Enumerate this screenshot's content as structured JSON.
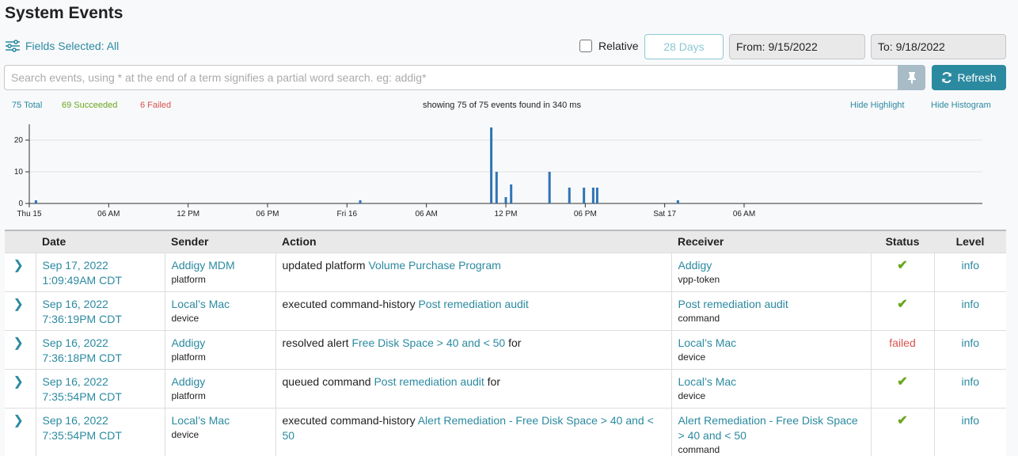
{
  "page": {
    "title": "System Events"
  },
  "toolbar": {
    "fields_label": "Fields Selected: All",
    "relative_label": "Relative",
    "days_label": "28 Days",
    "from_label": "From: 9/15/2022",
    "to_label": "To: 9/18/2022",
    "search_placeholder": "Search events, using * at the end of a term signifies a partial word search. eg: addig*",
    "refresh_label": "Refresh"
  },
  "summary": {
    "total": "75 Total",
    "succeeded": "69 Succeeded",
    "failed": "6 Failed",
    "showing": "showing 75 of 75 events found in 340 ms",
    "hide_highlight": "Hide Highlight",
    "hide_histogram": "Hide Histogram"
  },
  "chart_data": {
    "type": "bar",
    "ylim": [
      0,
      25
    ],
    "yticks": [
      0,
      10,
      20
    ],
    "xlim": [
      0,
      72
    ],
    "xticks": [
      {
        "t": 0,
        "label": "Thu 15"
      },
      {
        "t": 6,
        "label": "06 AM"
      },
      {
        "t": 12,
        "label": "12 PM"
      },
      {
        "t": 18,
        "label": "06 PM"
      },
      {
        "t": 24,
        "label": "Fri 16"
      },
      {
        "t": 30,
        "label": "06 AM"
      },
      {
        "t": 36,
        "label": "12 PM"
      },
      {
        "t": 42,
        "label": "06 PM"
      },
      {
        "t": 48,
        "label": "Sat 17"
      },
      {
        "t": 54,
        "label": "06 AM"
      }
    ],
    "series": [
      {
        "x": [
          0.5,
          25.0,
          34.9,
          35.3,
          36.0,
          36.4,
          39.3,
          40.8,
          41.9,
          42.6,
          42.9,
          49.0
        ],
        "values": [
          1,
          1,
          24,
          10,
          2,
          6,
          10,
          5,
          5,
          5,
          5,
          1
        ]
      }
    ],
    "color": "#2f74b5"
  },
  "table": {
    "headers": [
      "Date",
      "Sender",
      "Action",
      "Receiver",
      "Status",
      "Level"
    ],
    "rows": [
      {
        "date1": "Sep 17, 2022",
        "date2": "1:09:49AM CDT",
        "sender": "Addigy MDM",
        "sender_type": "platform",
        "action_pre": "updated platform ",
        "action_link": "Volume Purchase Program",
        "action_post": "",
        "receiver": "Addigy",
        "receiver_type": "vpp-token",
        "status": "",
        "level": "info"
      },
      {
        "date1": "Sep 16, 2022",
        "date2": "7:36:19PM CDT",
        "sender": "Local’s Mac",
        "sender_type": "device",
        "action_pre": "executed command-history ",
        "action_link": "Post remediation audit",
        "action_post": "",
        "receiver": "Post remediation audit",
        "receiver_type": "command",
        "status": "",
        "level": "info"
      },
      {
        "date1": "Sep 16, 2022",
        "date2": "7:36:18PM CDT",
        "sender": "Addigy",
        "sender_type": "platform",
        "action_pre": "resolved alert ",
        "action_link": "Free Disk Space > 40 and < 50",
        "action_post": " for",
        "receiver": "Local’s Mac",
        "receiver_type": "device",
        "status": "failed",
        "level": "info"
      },
      {
        "date1": "Sep 16, 2022",
        "date2": "7:35:54PM CDT",
        "sender": "Addigy",
        "sender_type": "platform",
        "action_pre": "queued command ",
        "action_link": "Post remediation audit",
        "action_post": " for",
        "receiver": "Local’s Mac",
        "receiver_type": "device",
        "status": "",
        "level": "info"
      },
      {
        "date1": "Sep 16, 2022",
        "date2": "7:35:54PM CDT",
        "sender": "Local’s Mac",
        "sender_type": "device",
        "action_pre": "executed command-history ",
        "action_link": "Alert Remediation - Free Disk Space > 40 and < 50",
        "action_post": "",
        "receiver": "Alert Remediation - Free Disk Space > 40 and < 50",
        "receiver_type": "command",
        "status": "",
        "level": "info"
      }
    ]
  }
}
